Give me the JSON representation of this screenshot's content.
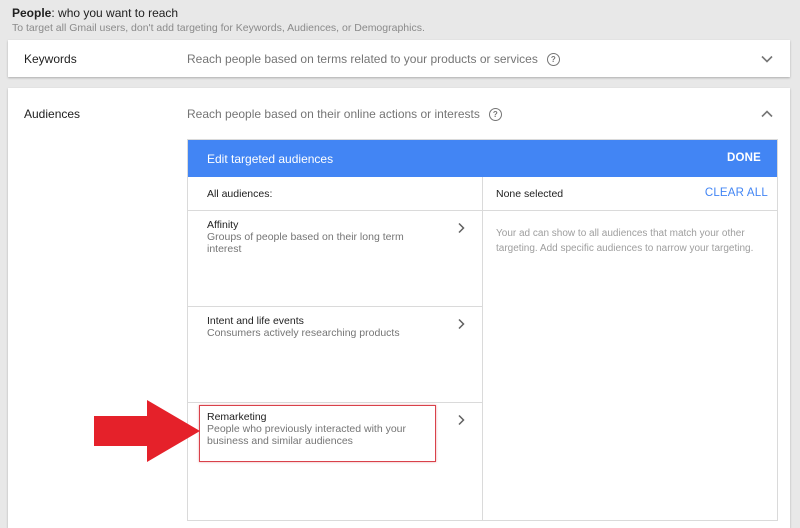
{
  "header": {
    "title_bold": "People",
    "title_rest": ": who you want to reach",
    "subtitle": "To target all Gmail users, don't add targeting for Keywords, Audiences, or Demographics."
  },
  "keywords": {
    "label": "Keywords",
    "description": "Reach people based on terms related to your products or services",
    "help": "?"
  },
  "audiences": {
    "label": "Audiences",
    "description": "Reach people based on their online actions or interests",
    "help": "?",
    "panel": {
      "title": "Edit targeted audiences",
      "done": "DONE",
      "left_header": "All audiences:",
      "right_header": "None selected",
      "clear_all": "CLEAR ALL",
      "right_text": "Your ad can show to all audiences that match your other targeting. Add specific audiences to narrow your targeting.",
      "categories": [
        {
          "title": "Affinity",
          "description": "Groups of people based on their long term interest"
        },
        {
          "title": "Intent and life events",
          "description": "Consumers actively researching products"
        },
        {
          "title": "Remarketing",
          "description": "People who previously interacted with your business and similar audiences"
        }
      ]
    }
  },
  "colors": {
    "accent": "#4285f4",
    "annotation_red": "#e5212a"
  },
  "icons": {
    "help": "help-icon",
    "expand": "chevron-down-icon",
    "collapse": "chevron-up-icon",
    "category_arrow": "chevron-right-icon"
  }
}
